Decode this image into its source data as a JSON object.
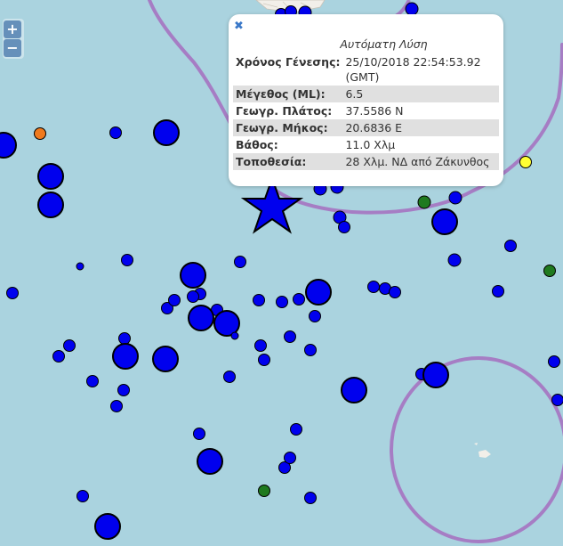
{
  "controls": {
    "zoom_in": "+",
    "zoom_out": "−"
  },
  "popup": {
    "close": "✖",
    "title": "Αυτόματη Λύση",
    "rows": [
      {
        "label": "Χρόνος Γένεσης:",
        "value": "25/10/2018 22:54:53.92 (GMT)"
      },
      {
        "label": "Μέγεθος (ML):",
        "value": "6.5"
      },
      {
        "label": "Γεωγρ. Πλάτος:",
        "value": "37.5586 N"
      },
      {
        "label": "Γεωγρ. Μήκος:",
        "value": "20.6836 E"
      },
      {
        "label": "Βάθος:",
        "value": "11.0 Χλμ"
      },
      {
        "label": "Τοποθεσία:",
        "value": "28 Χλμ. ΝΔ από Ζάκυνθος"
      }
    ]
  },
  "colors": {
    "sea": "#aad3df",
    "land": "#f2efe9",
    "boundary": "#a67dc4",
    "event_blue": "#0000ee",
    "event_green": "#1f7a1f",
    "event_orange": "#f07a1e",
    "event_yellow": "#ffff33"
  },
  "events": [
    {
      "c": "blue",
      "s": "m"
    },
    {
      "c": "blue",
      "s": "m"
    },
    {
      "c": "blue",
      "s": "m"
    },
    {
      "c": "blue",
      "s": "m"
    },
    {
      "c": "blue",
      "s": "m"
    },
    {
      "c": "green",
      "s": "m"
    },
    {
      "c": "blue",
      "s": "l"
    },
    {
      "c": "blue",
      "s": "m"
    },
    {
      "c": "blue",
      "s": "s"
    },
    {
      "c": "orange",
      "s": "s"
    },
    {
      "c": "blue",
      "s": "s"
    },
    {
      "c": "blue",
      "s": "l"
    },
    {
      "c": "blue",
      "s": "xl"
    },
    {
      "c": "yellow",
      "s": "s"
    },
    {
      "c": "blue",
      "s": "xl"
    },
    {
      "c": "blue",
      "s": "xl"
    },
    {
      "c": "blue",
      "s": "s"
    },
    {
      "c": "blue",
      "s": "m"
    },
    {
      "c": "green",
      "s": "s"
    },
    {
      "c": "blue",
      "s": "xs"
    },
    {
      "c": "blue",
      "s": "s"
    },
    {
      "c": "blue",
      "s": "s"
    },
    {
      "c": "blue",
      "s": "xl"
    },
    {
      "c": "blue",
      "s": "s"
    },
    {
      "c": "blue",
      "s": "s"
    },
    {
      "c": "blue",
      "s": "s"
    },
    {
      "c": "blue",
      "s": "s"
    },
    {
      "c": "blue",
      "s": "s"
    },
    {
      "c": "blue",
      "s": "s"
    },
    {
      "c": "blue",
      "s": "xl"
    },
    {
      "c": "blue",
      "s": "s"
    },
    {
      "c": "blue",
      "s": "s"
    },
    {
      "c": "blue",
      "s": "s"
    },
    {
      "c": "blue",
      "s": "xl"
    },
    {
      "c": "blue",
      "s": "s"
    },
    {
      "c": "blue",
      "s": "s"
    },
    {
      "c": "blue",
      "s": "s"
    },
    {
      "c": "blue",
      "s": "s"
    },
    {
      "c": "blue",
      "s": "s"
    },
    {
      "c": "blue",
      "s": "s"
    },
    {
      "c": "blue",
      "s": "s"
    },
    {
      "c": "blue",
      "s": "s"
    },
    {
      "c": "blue",
      "s": "xl"
    },
    {
      "c": "blue",
      "s": "xl"
    },
    {
      "c": "blue",
      "s": "xs"
    },
    {
      "c": "blue",
      "s": "s"
    },
    {
      "c": "blue",
      "s": "s"
    },
    {
      "c": "blue",
      "s": "s"
    },
    {
      "c": "blue",
      "s": "xl"
    },
    {
      "c": "blue",
      "s": "s"
    },
    {
      "c": "blue",
      "s": "s"
    },
    {
      "c": "blue",
      "s": "s"
    },
    {
      "c": "blue",
      "s": "s"
    },
    {
      "c": "blue",
      "s": "s"
    },
    {
      "c": "blue",
      "s": "xl"
    },
    {
      "c": "blue",
      "s": "s"
    },
    {
      "c": "blue",
      "s": "xl"
    },
    {
      "c": "blue",
      "s": "s"
    },
    {
      "c": "blue",
      "s": "s"
    },
    {
      "c": "blue",
      "s": "s"
    },
    {
      "c": "blue",
      "s": "s"
    },
    {
      "c": "blue",
      "s": "xl"
    },
    {
      "c": "blue",
      "s": "s"
    },
    {
      "c": "blue",
      "s": "s"
    },
    {
      "c": "green",
      "s": "s"
    },
    {
      "c": "blue",
      "s": "s"
    },
    {
      "c": "blue",
      "s": "s"
    },
    {
      "c": "blue",
      "s": "xl"
    },
    {
      "c": "blue",
      "s": "s"
    },
    {
      "c": "blue",
      "s": "s"
    }
  ]
}
